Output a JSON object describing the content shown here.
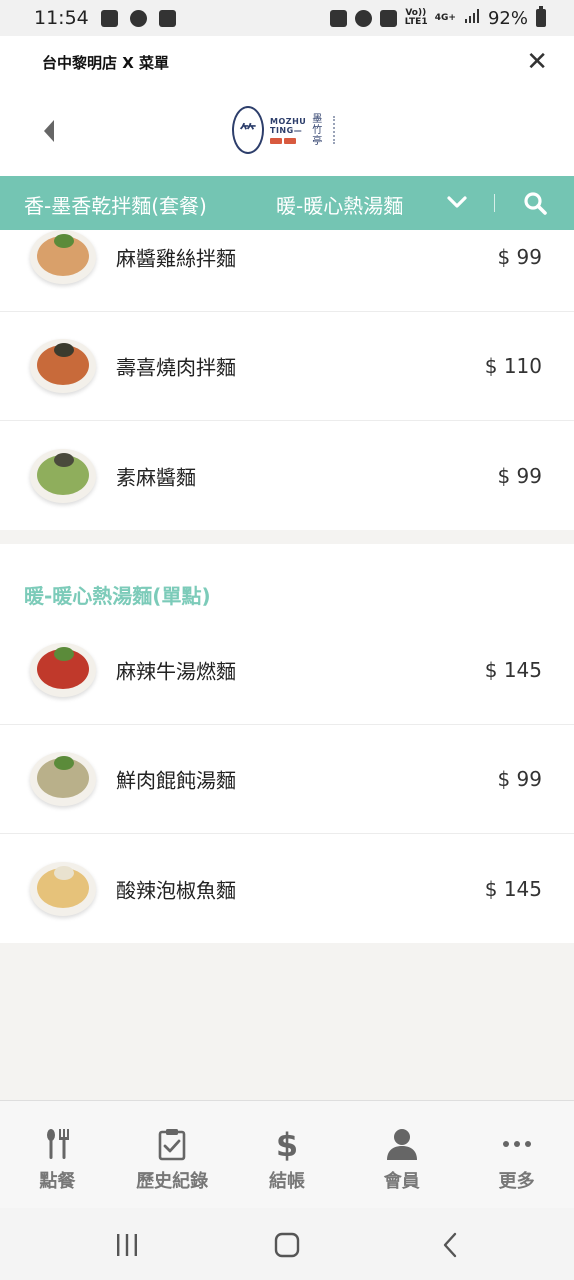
{
  "status_bar": {
    "time": "11:54",
    "network": "4G+",
    "volte": "Vo)) LTE1",
    "battery": "92%"
  },
  "header": {
    "title": "台中黎明店 X 菜單",
    "brand": {
      "latin_line1": "MOZHU",
      "latin_line2": "TING—",
      "chinese": "墨竹亭"
    }
  },
  "category_tabs": [
    {
      "label": "香-墨香乾拌麵(套餐)"
    },
    {
      "label": "暖-暖心熱湯麵"
    }
  ],
  "sections": [
    {
      "title": "",
      "items": [
        {
          "name": "麻醬雞絲拌麵",
          "price": "$ 99",
          "food_color": "#d9a06a"
        },
        {
          "name": "壽喜燒肉拌麵",
          "price": "$ 110",
          "food_color": "#c86a3a"
        },
        {
          "name": "素麻醬麵",
          "price": "$ 99",
          "food_color": "#8fae5c"
        }
      ]
    },
    {
      "title": "暖-暖心熱湯麵(單點)",
      "items": [
        {
          "name": "麻辣牛湯燃麵",
          "price": "$ 145",
          "food_color": "#c0392b"
        },
        {
          "name": "鮮肉餛飩湯麵",
          "price": "$ 99",
          "food_color": "#b9b08a"
        },
        {
          "name": "酸辣泡椒魚麵",
          "price": "$ 145",
          "food_color": "#e6c27a"
        }
      ]
    }
  ],
  "bottom_nav": [
    {
      "label": "點餐",
      "icon": "utensils-icon"
    },
    {
      "label": "歷史紀錄",
      "icon": "clipboard-check-icon"
    },
    {
      "label": "結帳",
      "icon": "dollar-icon"
    },
    {
      "label": "會員",
      "icon": "user-icon"
    },
    {
      "label": "更多",
      "icon": "more-dots-icon"
    }
  ],
  "colors": {
    "accent": "#74c5b3",
    "section_title": "#7ccbb9",
    "brand_navy": "#2d3e6b"
  }
}
